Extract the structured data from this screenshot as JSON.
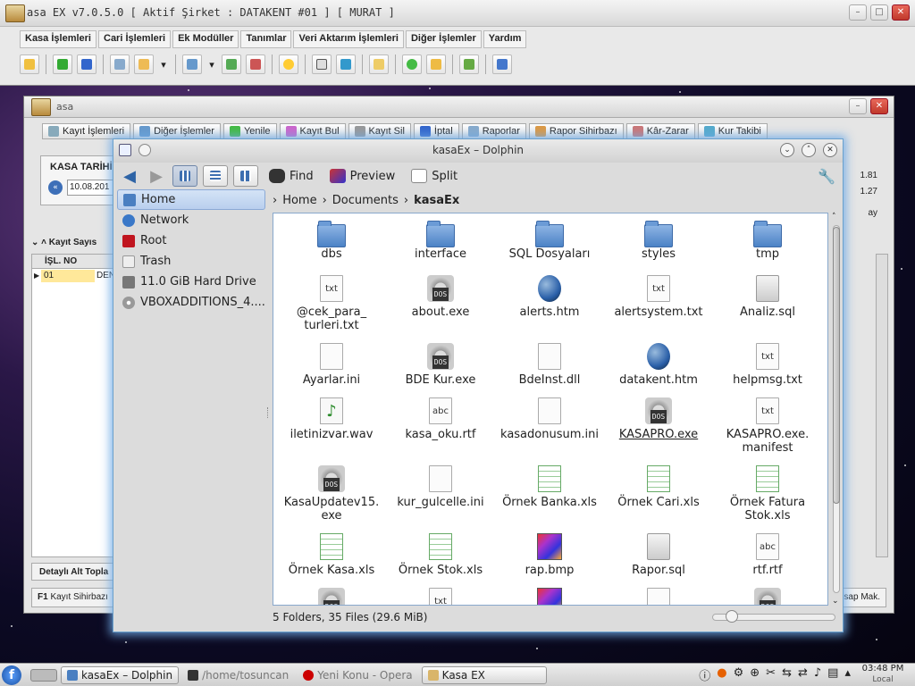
{
  "app": {
    "title": "asa EX v7.0.5.0 [ Aktif Şirket : DATAKENT #01 ] [ MURAT ]",
    "menu": [
      "Kasa İşlemleri",
      "Cari İşlemleri",
      "Ek Modüller",
      "Tanımlar",
      "Veri Aktarım İşlemleri",
      "Diğer İşlemler",
      "Yardım"
    ],
    "toolbar_icons": [
      "open-folder-icon",
      "expand-icon",
      "transfer-icon",
      "new-window-icon",
      "add-window-icon",
      "dropdown-icon",
      "list-icon",
      "dropdown-icon",
      "export-icon",
      "record-icon",
      "bell-icon",
      "card-icon",
      "document-icon",
      "report-icon",
      "refresh-icon",
      "edit-icon",
      "user-icon",
      "exit-icon"
    ]
  },
  "kasa": {
    "title": "asa",
    "tools": [
      "Kayıt İşlemleri",
      "Diğer İşlemler",
      "Yenile",
      "Kayıt Bul",
      "Kayıt Sil",
      "İptal",
      "Raporlar",
      "Rapor Sihirbazı",
      "Kâr-Zarar",
      "Kur Takibi"
    ],
    "date_label": "KASA TARİHİ",
    "date_value": "10.08.201",
    "rate1": "1.81",
    "rate2": "1.27",
    "ay_label": "ay",
    "kayit_label": "Kayıt Sayıs",
    "col_header": "İŞL. NO",
    "row_no": "01",
    "row_desc": "DEN",
    "detay_label": "Detaylı Alt Topla",
    "bottom_key": "F1",
    "bottom_text": "Kayıt Sihirbazı",
    "bottom_right": "esap Mak."
  },
  "dolphin": {
    "title": "kasaEx – Dolphin",
    "find": "Find",
    "preview": "Preview",
    "split": "Split",
    "places": [
      {
        "label": "Home",
        "icon": "home-icon",
        "color": "#4a7fc1"
      },
      {
        "label": "Network",
        "icon": "network-icon",
        "color": "#3a78c8"
      },
      {
        "label": "Root",
        "icon": "root-folder-icon",
        "color": "#c0151f"
      },
      {
        "label": "Trash",
        "icon": "trash-icon",
        "color": "#eeeeee"
      },
      {
        "label": "11.0 GiB Hard Drive",
        "icon": "hard-drive-icon",
        "color": "#777777"
      },
      {
        "label": "VBOXADDITIONS_4....",
        "icon": "cdrom-icon",
        "color": "#999999"
      }
    ],
    "breadcrumb": [
      "Home",
      "Documents",
      "kasaEx"
    ],
    "files": [
      {
        "name": "dbs",
        "type": "folder"
      },
      {
        "name": "interface",
        "type": "folder"
      },
      {
        "name": "SQL Dosyaları",
        "type": "folder"
      },
      {
        "name": "styles",
        "type": "folder"
      },
      {
        "name": "tmp",
        "type": "folder"
      },
      {
        "name": "@cek_para_\nturleri.txt",
        "type": "txt"
      },
      {
        "name": "about.exe",
        "type": "exe"
      },
      {
        "name": "alerts.htm",
        "type": "htm"
      },
      {
        "name": "alertsystem.txt",
        "type": "txt"
      },
      {
        "name": "Analiz.sql",
        "type": "sql"
      },
      {
        "name": "Ayarlar.ini",
        "type": "ini"
      },
      {
        "name": "BDE Kur.exe",
        "type": "exe"
      },
      {
        "name": "BdeInst.dll",
        "type": "ini"
      },
      {
        "name": "datakent.htm",
        "type": "htm"
      },
      {
        "name": "helpmsg.txt",
        "type": "txt"
      },
      {
        "name": "iletinizvar.wav",
        "type": "wav"
      },
      {
        "name": "kasa_oku.rtf",
        "type": "rtf"
      },
      {
        "name": "kasadonusum.ini",
        "type": "ini"
      },
      {
        "name": "KASAPRO.exe",
        "type": "exe"
      },
      {
        "name": "KASAPRO.exe.\nmanifest",
        "type": "txt"
      },
      {
        "name": "KasaUpdatev15.\nexe",
        "type": "exe"
      },
      {
        "name": "kur_gulcelle.ini",
        "type": "ini"
      },
      {
        "name": "Örnek Banka.xls",
        "type": "xls"
      },
      {
        "name": "Örnek Cari.xls",
        "type": "xls"
      },
      {
        "name": "Örnek Fatura\nStok.xls",
        "type": "xls"
      },
      {
        "name": "Örnek Kasa.xls",
        "type": "xls"
      },
      {
        "name": "Örnek Stok.xls",
        "type": "xls"
      },
      {
        "name": "rap.bmp",
        "type": "bmp"
      },
      {
        "name": "Rapor.sql",
        "type": "sql"
      },
      {
        "name": "rtf.rtf",
        "type": "rtf"
      },
      {
        "name": "",
        "type": "exe"
      },
      {
        "name": "",
        "type": "txt"
      },
      {
        "name": "",
        "type": "bmp"
      },
      {
        "name": "",
        "type": "ini"
      },
      {
        "name": "",
        "type": "exe"
      }
    ],
    "status": "5 Folders, 35 Files (29.6 MiB)"
  },
  "taskbar": {
    "tasks": [
      {
        "label": "kasaEx – Dolphin",
        "icon": "dolphin-icon",
        "state": "active"
      },
      {
        "label": "/home/tosuncan",
        "icon": "terminal-icon",
        "state": "dim"
      },
      {
        "label": "Yeni Konu - Opera",
        "icon": "opera-icon",
        "state": "dim"
      },
      {
        "label": "Kasa EX",
        "icon": "kasa-icon",
        "state": "active"
      }
    ],
    "time": "03:48 PM",
    "zone": "Local"
  }
}
